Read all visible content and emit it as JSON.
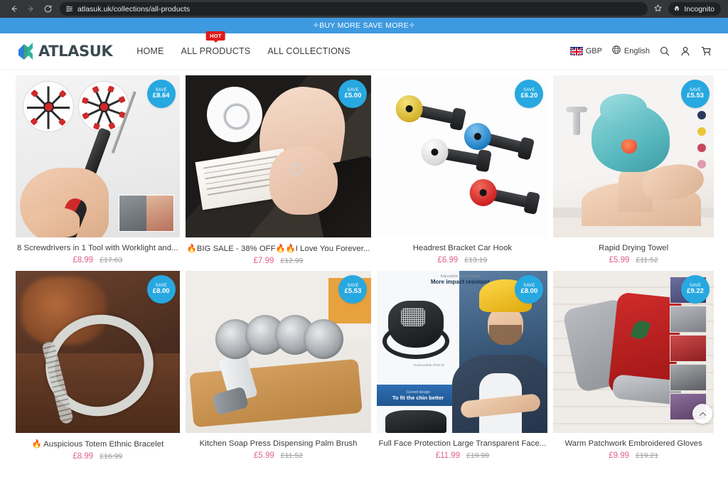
{
  "browser": {
    "back_icon": "back-arrow-icon",
    "forward_icon": "forward-arrow-icon",
    "reload_icon": "reload-icon",
    "site_info_icon": "site-settings-icon",
    "url": "atlasuk.uk/collections/all-products",
    "bookmark_icon": "star-icon",
    "incognito_label": "Incognito",
    "incognito_icon": "incognito-hat-icon"
  },
  "announcement": {
    "text": "✧BUY MORE SAVE MORE✧",
    "bg": "#3e9ae0"
  },
  "header": {
    "logo_text": "ATLASUK",
    "logo_colors": [
      "#2bb5a0",
      "#2f7fd6"
    ],
    "nav": [
      {
        "label": "HOME",
        "badge": null
      },
      {
        "label": "ALL PRODUCTS",
        "badge": "HOT"
      },
      {
        "label": "ALL COLLECTIONS",
        "badge": null
      }
    ],
    "currency": {
      "label": "GBP",
      "icon": "uk-flag-icon"
    },
    "language": {
      "label": "English",
      "icon": "globe-icon"
    },
    "icons": [
      "search-icon",
      "account-icon",
      "cart-icon"
    ]
  },
  "grid": {
    "save_prefix": "SAVE",
    "badge_color": "#27a8e0",
    "sale_color": "#e06287",
    "compare_color": "#9b9b9b",
    "products": [
      {
        "title": "8 Screwdrivers in 1 Tool with Worklight and...",
        "sale_price": "£8.99",
        "compare_price": "£17.63",
        "save_label": "SAVE",
        "save_amount": "£8.64",
        "swatches": []
      },
      {
        "title": "🔥BIG SALE - 38% OFF🔥🔥I Love You Forever...",
        "sale_price": "£7.99",
        "compare_price": "£12.99",
        "save_label": "SAVE",
        "save_amount": "£5.00",
        "swatches": []
      },
      {
        "title": "Headrest Bracket Car Hook",
        "sale_price": "£6.99",
        "compare_price": "£13.19",
        "save_label": "SAVE",
        "save_amount": "£6.20",
        "swatches": []
      },
      {
        "title": "Rapid Drying Towel",
        "sale_price": "£5.99",
        "compare_price": "£11.52",
        "save_label": "SAVE",
        "save_amount": "£5.53",
        "swatches": [
          "#2b3a5c",
          "#e8c63a",
          "#c8485e",
          "#e09aae"
        ]
      },
      {
        "title": "🔥 Auspicious Totem Ethnic Bracelet",
        "sale_price": "£8.99",
        "compare_price": "£16.99",
        "save_label": "SAVE",
        "save_amount": "£8.00",
        "swatches": []
      },
      {
        "title": "Kitchen Soap Press Dispensing Palm Brush",
        "sale_price": "£5.99",
        "compare_price": "£11.52",
        "save_label": "SAVE",
        "save_amount": "£5.53",
        "swatches": []
      },
      {
        "title": "Full Face Protection Large Transparent Face...",
        "sale_price": "£11.99",
        "compare_price": "£19.99",
        "save_label": "SAVE",
        "save_amount": "£8.00",
        "swatches": []
      },
      {
        "title": "Warm Patchwork Embroidered Gloves",
        "sale_price": "£9.99",
        "compare_price": "£19.21",
        "save_label": "SAVE",
        "save_amount": "£9.22",
        "swatches": []
      }
    ]
  },
  "image_text": {
    "face_shield_line1": "Adjustable elastic band",
    "face_shield_line2": "More impact resistant",
    "face_shield_pm": "Replaceable (PM2.5)",
    "face_shield_line3": "Curved design",
    "face_shield_line4": "To fit the chin better"
  },
  "scroll_top": {
    "icon": "chevron-up-icon"
  }
}
